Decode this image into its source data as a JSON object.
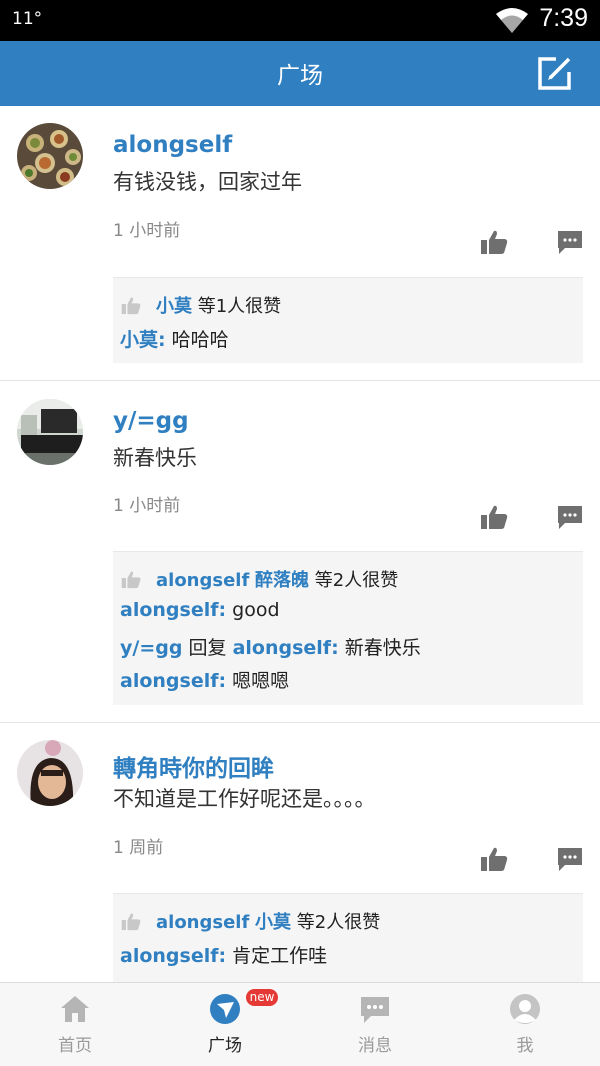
{
  "status_bar": {
    "left_text": "11°",
    "time": "7:39"
  },
  "header": {
    "title": "广场"
  },
  "posts": [
    {
      "username": "alongself",
      "content": "有钱没钱，回家过年",
      "time": "1 小时前",
      "likes": {
        "names": [
          "小莫"
        ],
        "suffix": "等1人很赞"
      },
      "comments": [
        {
          "author": "小莫",
          "text": "哈哈哈"
        }
      ]
    },
    {
      "username": "y/=gg",
      "content": "新春快乐",
      "time": "1 小时前",
      "likes": {
        "names": [
          "alongself",
          "醉落魄"
        ],
        "suffix": "等2人很赞"
      },
      "comments": [
        {
          "author": "alongself",
          "text": "good"
        },
        {
          "author": "y/=gg",
          "reply_word": "回复",
          "reply_to": "alongself",
          "text": "新春快乐"
        },
        {
          "author": "alongself",
          "text": "嗯嗯嗯"
        }
      ]
    },
    {
      "username": "轉角時你的回眸",
      "content": "不知道是工作好呢还是。。。。",
      "time": "1 周前",
      "likes": {
        "names": [
          "alongself",
          "小莫"
        ],
        "suffix": "等2人很赞"
      },
      "comments": [
        {
          "author": "alongself",
          "text": "肯定工作哇"
        }
      ]
    }
  ],
  "bottom_nav": [
    {
      "label": "首页",
      "icon": "home-icon",
      "active": false
    },
    {
      "label": "广场",
      "icon": "square-compass-icon",
      "active": true
    },
    {
      "label": "消息",
      "icon": "message-icon",
      "active": false,
      "badge": "new"
    },
    {
      "label": "我",
      "icon": "profile-icon",
      "active": false
    }
  ],
  "colors": {
    "primary": "#2f7fc1",
    "badge": "#e53935",
    "inactive": "#9a9a9a"
  }
}
